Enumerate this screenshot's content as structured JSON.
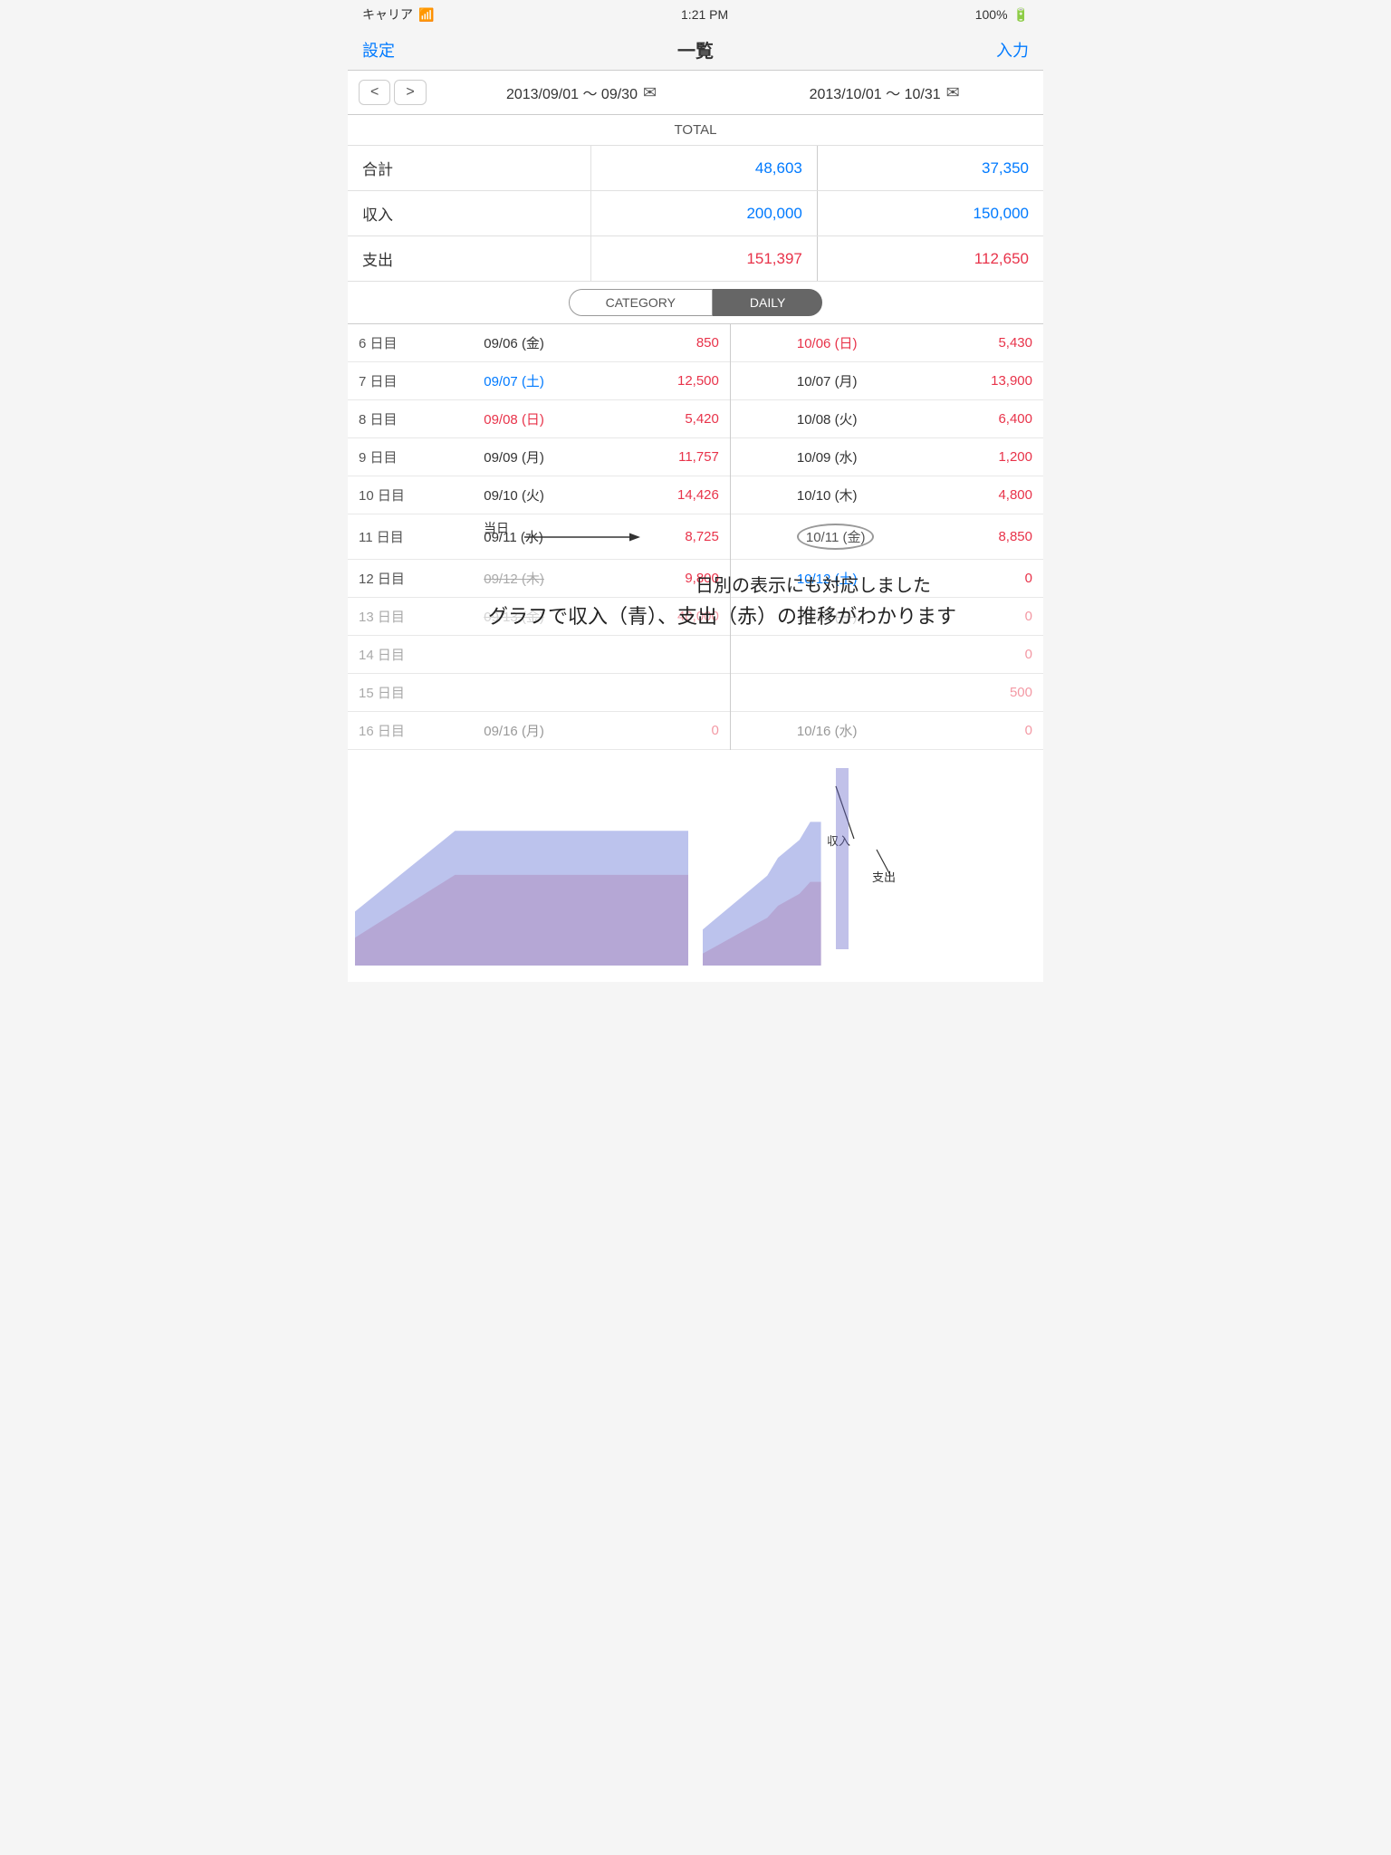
{
  "statusBar": {
    "carrier": "キャリア",
    "wifi": "WiFi",
    "time": "1:21 PM",
    "battery": "100%"
  },
  "navBar": {
    "leftLabel": "設定",
    "title": "一覧",
    "rightLabel": "入力"
  },
  "periods": {
    "prev": "<",
    "next": ">",
    "period1": "2013/09/01 ～ 09/30",
    "period2": "2013/10/01 ～ 10/31"
  },
  "total": {
    "header": "TOTAL",
    "rows": [
      {
        "label": "合計",
        "val1": "48,603",
        "val2": "37,350",
        "color1": "blue",
        "color2": "blue"
      },
      {
        "label": "収入",
        "val1": "200,000",
        "val2": "150,000",
        "color1": "blue",
        "color2": "blue"
      },
      {
        "label": "支出",
        "val1": "151,397",
        "val2": "112,650",
        "color1": "red",
        "color2": "red"
      }
    ]
  },
  "toggleButtons": {
    "category": "CATEGORY",
    "daily": "DAILY"
  },
  "dailyRows": [
    {
      "dayLabel": "6 日目",
      "date1": "09/06 (金)",
      "date1Type": "fri",
      "amount1": "850",
      "amount1Color": "red",
      "date2": "10/06 (日)",
      "date2Type": "sun",
      "amount2": "5,430",
      "amount2Color": "red"
    },
    {
      "dayLabel": "7 日目",
      "date1": "09/07 (土)",
      "date1Type": "sat",
      "amount1": "12,500",
      "amount1Color": "red",
      "date2": "10/07 (月)",
      "date2Type": "normal",
      "amount2": "13,900",
      "amount2Color": "red"
    },
    {
      "dayLabel": "8 日目",
      "date1": "09/08 (日)",
      "date1Type": "sun",
      "amount1": "5,420",
      "amount1Color": "red",
      "date2": "10/08 (火)",
      "date2Type": "normal",
      "amount2": "6,400",
      "amount2Color": "red"
    },
    {
      "dayLabel": "9 日目",
      "date1": "09/09 (月)",
      "date1Type": "normal",
      "amount1": "11,757",
      "amount1Color": "red",
      "date2": "10/09 (水)",
      "date2Type": "normal",
      "amount2": "1,200",
      "amount2Color": "red"
    },
    {
      "dayLabel": "10 日目",
      "date1": "09/10 (火)",
      "date1Type": "normal",
      "amount1": "14,426",
      "amount1Color": "red",
      "date2": "10/10 (木)",
      "date2Type": "normal",
      "amount2": "4,800",
      "amount2Color": "red"
    },
    {
      "dayLabel": "11 日目",
      "date1": "09/11 (水)",
      "date1Type": "normal",
      "amount1": "8,725",
      "amount1Color": "red",
      "date2": "10/11 (金)",
      "date2Type": "fri-circle",
      "amount2": "8,850",
      "amount2Color": "red"
    },
    {
      "dayLabel": "12 日目",
      "date1": "09/12 (木)",
      "date1Type": "strikethrough",
      "amount1": "9,800",
      "amount1Color": "red",
      "date2": "10/12 (土)",
      "date2Type": "sat",
      "amount2": "0",
      "amount2Color": "red"
    },
    {
      "dayLabel": "13 日目",
      "date1": "09/13 (金)",
      "date1Type": "strikethrough",
      "amount1": "40,000",
      "amount1Color": "red",
      "date2": "10/13 (日)",
      "date2Type": "strikethrough",
      "amount2": "0",
      "amount2Color": "red"
    },
    {
      "dayLabel": "14 日目",
      "date1": "",
      "date1Type": "normal",
      "amount1": "",
      "amount1Color": "red",
      "date2": "",
      "date2Type": "normal",
      "amount2": "0",
      "amount2Color": "red"
    },
    {
      "dayLabel": "15 日目",
      "date1": "",
      "date1Type": "normal",
      "amount1": "",
      "amount1Color": "red",
      "date2": "",
      "date2Type": "normal",
      "amount2": "500",
      "amount2Color": "red"
    },
    {
      "dayLabel": "16 日目",
      "date1": "09/16 (月)",
      "date1Type": "normal",
      "amount1": "0",
      "amount1Color": "red",
      "date2": "10/16 (水)",
      "date2Type": "normal",
      "amount2": "0",
      "amount2Color": "red"
    }
  ],
  "annotations": {
    "tojitsu": "当日",
    "text1": "日別の表示にも対応しました",
    "text2": "グラフで収入（青）、支出（赤）の推移がわかります",
    "income": "収入",
    "expense": "支出"
  },
  "charts": {
    "leftBars": [
      0.2,
      0.25,
      0.3,
      0.35,
      0.4,
      0.45,
      0.5,
      0.55,
      0.6,
      0.65,
      0.65,
      0.65,
      0.65,
      0.65,
      0.65,
      0.65,
      0.65,
      0.65,
      0.65,
      0.65,
      0.65,
      0.65,
      0.65,
      0.65,
      0.65,
      0.65,
      0.65,
      0.65,
      0.65,
      0.65
    ],
    "rightBars": [
      0.1,
      0.15,
      0.2,
      0.25,
      0.3,
      0.35,
      0.4,
      0.5,
      0.55,
      0.6,
      0.7
    ]
  }
}
